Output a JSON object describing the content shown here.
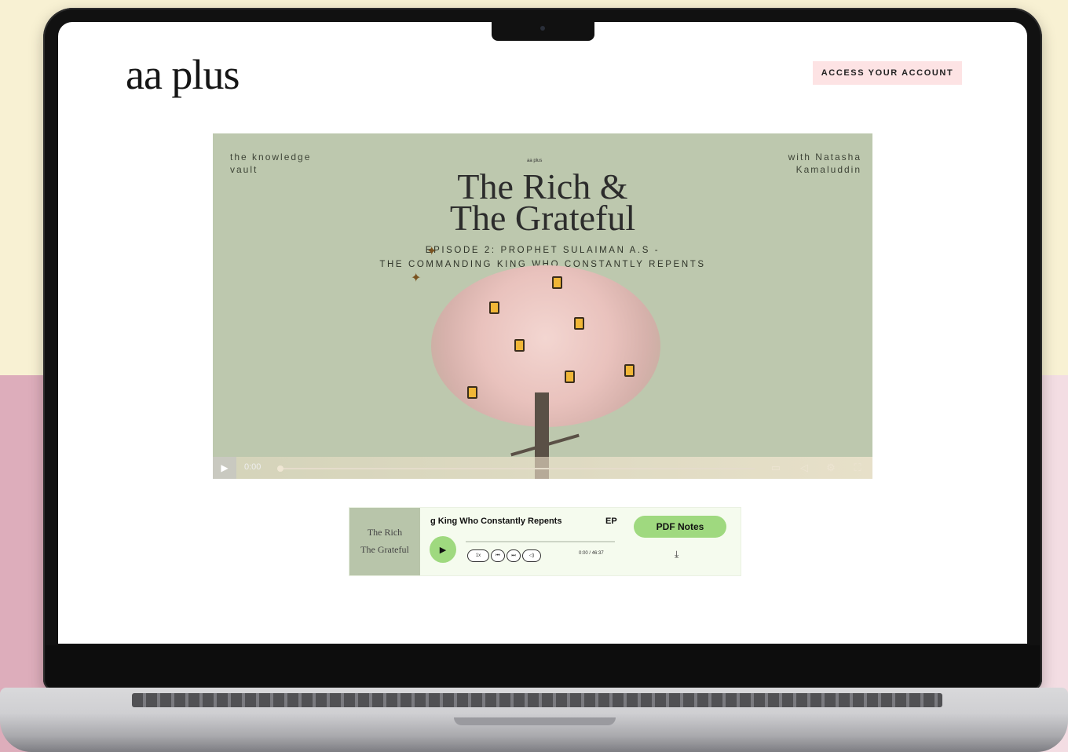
{
  "header": {
    "logo": "aa plus",
    "account_button": "ACCESS YOUR ACCOUNT"
  },
  "video": {
    "top_left": "the knowledge vault",
    "top_right": "with Natasha Kamaluddin",
    "brand_mark": "aa plus",
    "title_line1": "The Rich &",
    "title_line2": "The Grateful",
    "subtitle_line1": "EPISODE 2: PROPHET SULAIMAN A.S -",
    "subtitle_line2": "THE COMMANDING KING WHO CONSTANTLY REPENTS",
    "time": "0:00",
    "progress": 0
  },
  "audio": {
    "thumb_line1": "The Rich",
    "thumb_line2": "The Grateful",
    "title": "g King Who Constantly Repents",
    "ep": "EP",
    "speed": "1x",
    "current_time": "0:00",
    "duration": "46:37",
    "pdf_button": "PDF Notes",
    "progress": 0
  },
  "colors": {
    "accent_green": "#9fd97f",
    "account_bg": "#fde3e4",
    "video_bg": "#bdc8ae"
  }
}
